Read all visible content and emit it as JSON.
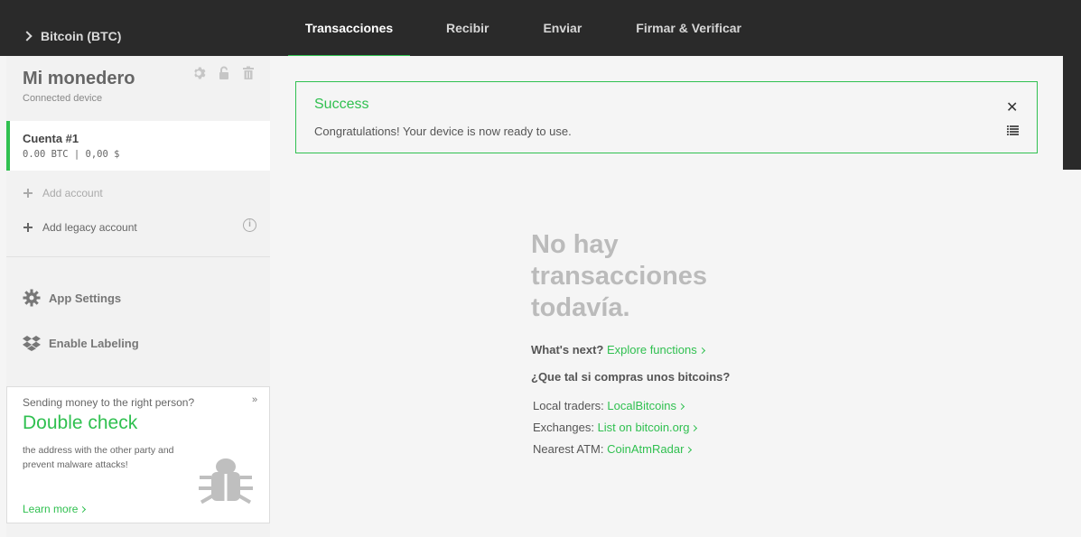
{
  "header": {
    "coin": "Bitcoin (BTC)",
    "tabs": [
      {
        "label": "Transacciones",
        "active": true
      },
      {
        "label": "Recibir",
        "active": false
      },
      {
        "label": "Enviar",
        "active": false
      },
      {
        "label": "Firmar & Verificar",
        "active": false
      }
    ]
  },
  "sidebar": {
    "wallet_title": "Mi monedero",
    "wallet_sub": "Connected device",
    "icons": [
      "gear-icon",
      "unlock-icon",
      "trash-icon"
    ],
    "account": {
      "name": "Cuenta #1",
      "balance": "0.00 BTC | 0,00 $"
    },
    "add_account": "Add account",
    "add_legacy": "Add legacy account",
    "info_glyph": "i",
    "app_settings": "App Settings",
    "enable_labeling": "Enable Labeling"
  },
  "promo": {
    "top": "Sending money to the right person?",
    "close": "»",
    "title": "Double check",
    "text": "the address with the other party and prevent malware attacks!",
    "link": "Learn more"
  },
  "alert": {
    "title": "Success",
    "message": "Congratulations! Your device is now ready to use.",
    "close": "✕"
  },
  "empty": {
    "title": "No hay transacciones todavía.",
    "next_label": "What's next?",
    "next_link": "Explore functions",
    "buy_question": "¿Que tal si compras unos bitcoins?",
    "local_label": "Local traders:",
    "local_link": "LocalBitcoins",
    "exchanges_label": "Exchanges:",
    "exchanges_link": "List on bitcoin.org",
    "atm_label": "Nearest ATM:",
    "atm_link": "CoinAtmRadar"
  },
  "colors": {
    "accent": "#30c050",
    "topbar": "#2a2a2a"
  }
}
